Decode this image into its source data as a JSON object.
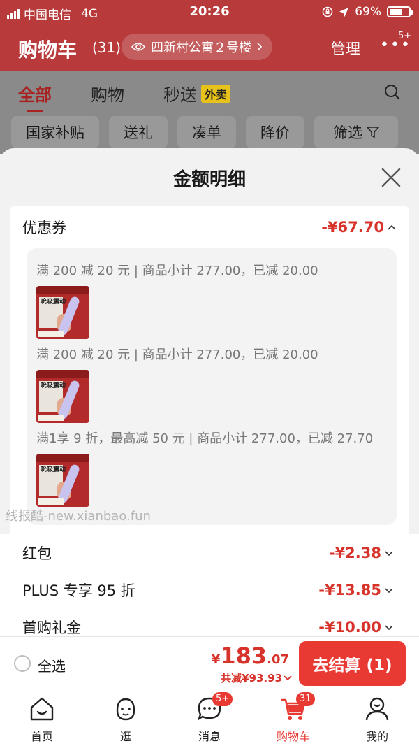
{
  "status_bar": {
    "carrier": "中国电信",
    "network": "4G",
    "time": "20:26",
    "battery": "69%"
  },
  "header": {
    "title": "购物车",
    "count": "(31)",
    "address": "四新村公寓２号楼",
    "manage": "管理",
    "more": "•••",
    "more_badge": "5+"
  },
  "tabs": [
    {
      "label": "全部"
    },
    {
      "label": "购物"
    },
    {
      "label": "秒送",
      "tag": "外卖"
    }
  ],
  "filters": [
    "国家补贴",
    "送礼",
    "凑单",
    "降价",
    "筛选"
  ],
  "sheet": {
    "title": "金额明细",
    "coupon": {
      "label": "优惠券",
      "amount": "-¥67.70",
      "items": [
        {
          "text": "满 200 减 20 元 | 商品小计 277.00，已减 20.00"
        },
        {
          "text": "满 200 减 20 元 | 商品小计 277.00，已减 20.00"
        },
        {
          "text": "满1享 9 折，最高减 50 元 | 商品小计 277.00，已减 27.70"
        }
      ]
    },
    "rows": [
      {
        "label": "红包",
        "amount": "-¥2.38"
      },
      {
        "label": "PLUS 专享 95 折",
        "amount": "-¥13.85"
      },
      {
        "label": "首购礼金",
        "amount": "-¥10.00"
      }
    ],
    "product_thumb_text": "吮吸震动",
    "watermark": "线报酷-new.xianbao.fun"
  },
  "checkout": {
    "select_all": "全选",
    "currency": "¥",
    "price_int": "183",
    "price_dec": ".07",
    "saved": "共减¥93.93",
    "button": "去结算 (1)"
  },
  "tabbar": [
    {
      "label": "首页"
    },
    {
      "label": "逛"
    },
    {
      "label": "消息",
      "badge": "5+"
    },
    {
      "label": "购物车",
      "badge": "31"
    },
    {
      "label": "我的"
    }
  ],
  "colors": {
    "brand_red": "#e83a33",
    "price_red": "#d8332a",
    "header_red": "#b83a3a"
  }
}
